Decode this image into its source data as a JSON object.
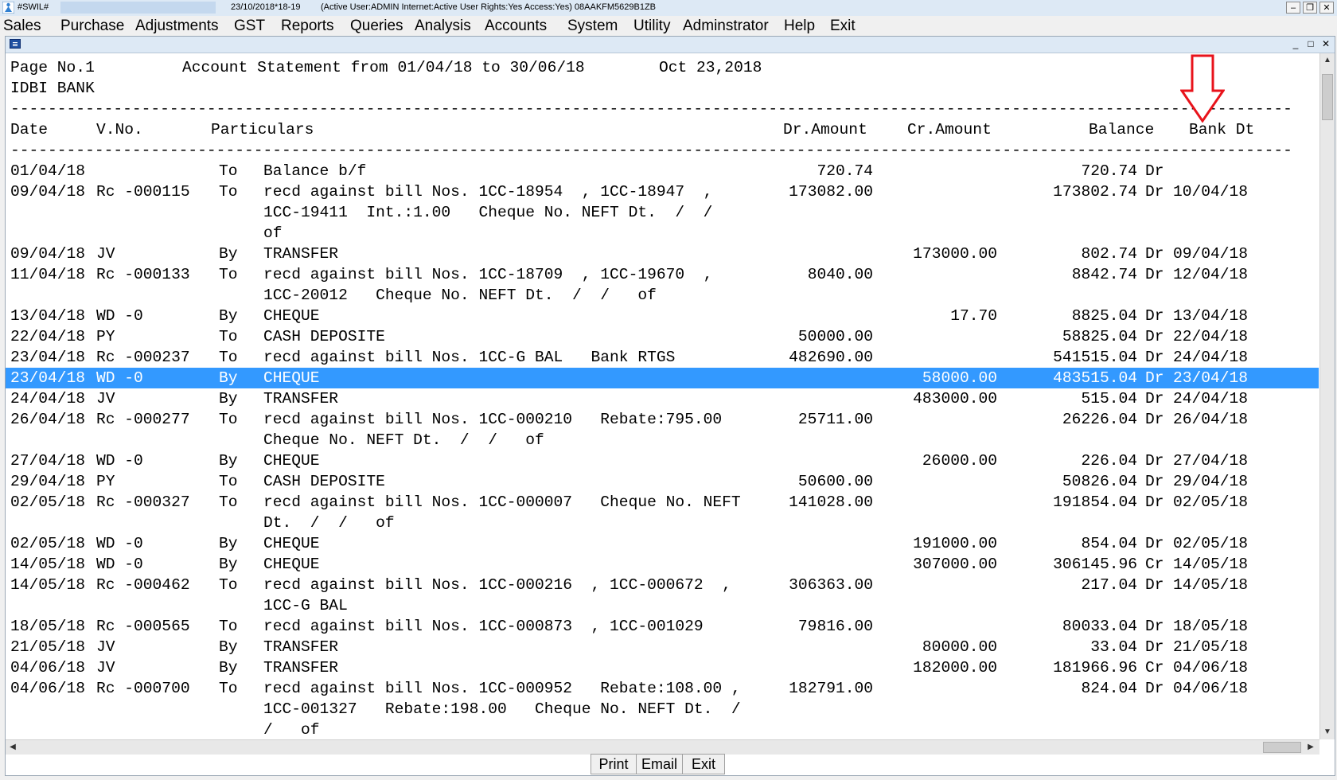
{
  "titlebar": {
    "app_name": "#SWIL#",
    "date": "23/10/2018*18-19",
    "status": "(Active User:ADMIN Internet:Active  User Rights:Yes Access:Yes) 08AAKFM5629B1ZB",
    "minimize": "–",
    "restore": "❐",
    "close": "✕"
  },
  "menu": {
    "items": [
      "Sales",
      "Purchase",
      "Adjustments",
      "GST",
      "Reports",
      "Queries",
      "Analysis",
      "Accounts",
      "System",
      "Utility",
      "Adminstrator",
      "Help",
      "Exit"
    ]
  },
  "child_window": {
    "minimize": "_",
    "restore": "□",
    "close": "✕"
  },
  "report": {
    "page_no": "Page No.1",
    "heading": "Account Statement from 01/04/18 to 30/06/18",
    "print_date": "Oct 23,2018",
    "account": "IDBI BANK",
    "rule": "------------------------------------------------------------------------------------------------------------------------------------------------------------------------------------------------",
    "columns": {
      "date": "Date",
      "vno": "V.No.",
      "particulars": "Particulars",
      "dr": "Dr.Amount",
      "cr": "Cr.Amount",
      "balance": "Balance",
      "bankdt": "Bank Dt"
    },
    "rows": [
      {
        "date": "01/04/18",
        "vno": "",
        "toby": "To",
        "part": "Balance b/f",
        "dr": "720.74",
        "cr": "",
        "bal": "720.74",
        "drcr": "Dr",
        "bankdt": ""
      },
      {
        "date": "09/04/18",
        "vno": "Rc -000115",
        "toby": "To",
        "part": "recd against bill Nos. 1CC-18954  , 1CC-18947  ,",
        "dr": "173082.00",
        "cr": "",
        "bal": "173802.74",
        "drcr": "Dr",
        "bankdt": "10/04/18"
      },
      {
        "date": "",
        "vno": "",
        "toby": "",
        "part": "1CC-19411  Int.:1.00   Cheque No. NEFT Dt.  /  /",
        "dr": "",
        "cr": "",
        "bal": "",
        "drcr": "",
        "bankdt": ""
      },
      {
        "date": "",
        "vno": "",
        "toby": "",
        "part": "of",
        "dr": "",
        "cr": "",
        "bal": "",
        "drcr": "",
        "bankdt": ""
      },
      {
        "date": "09/04/18",
        "vno": "JV",
        "toby": "By",
        "part": "TRANSFER",
        "dr": "",
        "cr": "173000.00",
        "bal": "802.74",
        "drcr": "Dr",
        "bankdt": "09/04/18"
      },
      {
        "date": "11/04/18",
        "vno": "Rc -000133",
        "toby": "To",
        "part": "recd against bill Nos. 1CC-18709  , 1CC-19670  ,",
        "dr": "8040.00",
        "cr": "",
        "bal": "8842.74",
        "drcr": "Dr",
        "bankdt": "12/04/18"
      },
      {
        "date": "",
        "vno": "",
        "toby": "",
        "part": "1CC-20012   Cheque No. NEFT Dt.  /  /   of",
        "dr": "",
        "cr": "",
        "bal": "",
        "drcr": "",
        "bankdt": ""
      },
      {
        "date": "13/04/18",
        "vno": "WD -0",
        "toby": "By",
        "part": "CHEQUE",
        "dr": "",
        "cr": "17.70",
        "bal": "8825.04",
        "drcr": "Dr",
        "bankdt": "13/04/18"
      },
      {
        "date": "22/04/18",
        "vno": "PY",
        "toby": "To",
        "part": "CASH DEPOSITE",
        "dr": "50000.00",
        "cr": "",
        "bal": "58825.04",
        "drcr": "Dr",
        "bankdt": "22/04/18"
      },
      {
        "date": "23/04/18",
        "vno": "Rc -000237",
        "toby": "To",
        "part": "recd against bill Nos. 1CC-G BAL   Bank RTGS",
        "dr": "482690.00",
        "cr": "",
        "bal": "541515.04",
        "drcr": "Dr",
        "bankdt": "24/04/18"
      },
      {
        "date": "23/04/18",
        "vno": "WD -0",
        "toby": "By",
        "part": "CHEQUE",
        "dr": "",
        "cr": "58000.00",
        "bal": "483515.04",
        "drcr": "Dr",
        "bankdt": "23/04/18",
        "selected": true
      },
      {
        "date": "24/04/18",
        "vno": "JV",
        "toby": "By",
        "part": "TRANSFER",
        "dr": "",
        "cr": "483000.00",
        "bal": "515.04",
        "drcr": "Dr",
        "bankdt": "24/04/18"
      },
      {
        "date": "26/04/18",
        "vno": "Rc -000277",
        "toby": "To",
        "part": "recd against bill Nos. 1CC-000210   Rebate:795.00",
        "dr": "25711.00",
        "cr": "",
        "bal": "26226.04",
        "drcr": "Dr",
        "bankdt": "26/04/18"
      },
      {
        "date": "",
        "vno": "",
        "toby": "",
        "part": "Cheque No. NEFT Dt.  /  /   of",
        "dr": "",
        "cr": "",
        "bal": "",
        "drcr": "",
        "bankdt": ""
      },
      {
        "date": "27/04/18",
        "vno": "WD -0",
        "toby": "By",
        "part": "CHEQUE",
        "dr": "",
        "cr": "26000.00",
        "bal": "226.04",
        "drcr": "Dr",
        "bankdt": "27/04/18"
      },
      {
        "date": "29/04/18",
        "vno": "PY",
        "toby": "To",
        "part": "CASH DEPOSITE",
        "dr": "50600.00",
        "cr": "",
        "bal": "50826.04",
        "drcr": "Dr",
        "bankdt": "29/04/18"
      },
      {
        "date": "02/05/18",
        "vno": "Rc -000327",
        "toby": "To",
        "part": "recd against bill Nos. 1CC-000007   Cheque No. NEFT",
        "dr": "141028.00",
        "cr": "",
        "bal": "191854.04",
        "drcr": "Dr",
        "bankdt": "02/05/18"
      },
      {
        "date": "",
        "vno": "",
        "toby": "",
        "part": "Dt.  /  /   of",
        "dr": "",
        "cr": "",
        "bal": "",
        "drcr": "",
        "bankdt": ""
      },
      {
        "date": "02/05/18",
        "vno": "WD -0",
        "toby": "By",
        "part": "CHEQUE",
        "dr": "",
        "cr": "191000.00",
        "bal": "854.04",
        "drcr": "Dr",
        "bankdt": "02/05/18"
      },
      {
        "date": "14/05/18",
        "vno": "WD -0",
        "toby": "By",
        "part": "CHEQUE",
        "dr": "",
        "cr": "307000.00",
        "bal": "306145.96",
        "drcr": "Cr",
        "bankdt": "14/05/18"
      },
      {
        "date": "14/05/18",
        "vno": "Rc -000462",
        "toby": "To",
        "part": "recd against bill Nos. 1CC-000216  , 1CC-000672  ,",
        "dr": "306363.00",
        "cr": "",
        "bal": "217.04",
        "drcr": "Dr",
        "bankdt": "14/05/18"
      },
      {
        "date": "",
        "vno": "",
        "toby": "",
        "part": "1CC-G BAL",
        "dr": "",
        "cr": "",
        "bal": "",
        "drcr": "",
        "bankdt": ""
      },
      {
        "date": "18/05/18",
        "vno": "Rc -000565",
        "toby": "To",
        "part": "recd against bill Nos. 1CC-000873  , 1CC-001029",
        "dr": "79816.00",
        "cr": "",
        "bal": "80033.04",
        "drcr": "Dr",
        "bankdt": "18/05/18"
      },
      {
        "date": "21/05/18",
        "vno": "JV",
        "toby": "By",
        "part": "TRANSFER",
        "dr": "",
        "cr": "80000.00",
        "bal": "33.04",
        "drcr": "Dr",
        "bankdt": "21/05/18"
      },
      {
        "date": "04/06/18",
        "vno": "JV",
        "toby": "By",
        "part": "TRANSFER",
        "dr": "",
        "cr": "182000.00",
        "bal": "181966.96",
        "drcr": "Cr",
        "bankdt": "04/06/18"
      },
      {
        "date": "04/06/18",
        "vno": "Rc -000700",
        "toby": "To",
        "part": "recd against bill Nos. 1CC-000952   Rebate:108.00 ,",
        "dr": "182791.00",
        "cr": "",
        "bal": "824.04",
        "drcr": "Dr",
        "bankdt": "04/06/18"
      },
      {
        "date": "",
        "vno": "",
        "toby": "",
        "part": "1CC-001327   Rebate:198.00   Cheque No. NEFT Dt.  /",
        "dr": "",
        "cr": "",
        "bal": "",
        "drcr": "",
        "bankdt": ""
      },
      {
        "date": "",
        "vno": "",
        "toby": "",
        "part": "/   of",
        "dr": "",
        "cr": "",
        "bal": "",
        "drcr": "",
        "bankdt": ""
      }
    ]
  },
  "footer": {
    "print": "Print",
    "email": "Email",
    "exit": "Exit"
  },
  "colors": {
    "selection": "#3399ff",
    "annotation_arrow": "#e8131b"
  },
  "icons": {
    "app": "app-logo-icon",
    "annotation": "down-arrow-icon"
  }
}
